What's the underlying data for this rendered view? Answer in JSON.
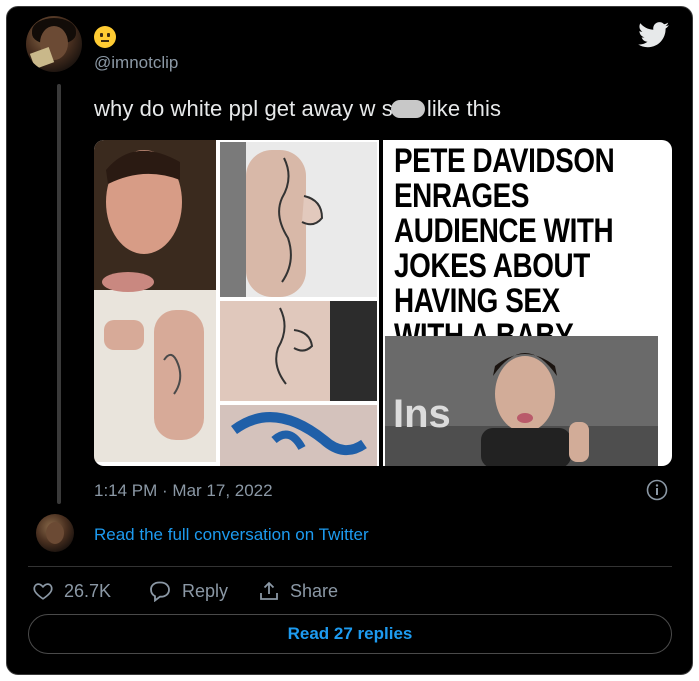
{
  "tweet": {
    "handle": "@imnotclip",
    "text_before": "why do white ppl get away w s",
    "text_after": "like this",
    "timestamp": "1:14 PM · Mar 17, 2022"
  },
  "media": {
    "headline": "PETE DAVIDSON ENRAGES AUDIENCE WITH JOKES ABOUT HAVING SEX WITH A BABY",
    "watermark": "Ins"
  },
  "conversation": {
    "link_label": "Read the full conversation on Twitter"
  },
  "actions": {
    "likes_count": "26.7K",
    "reply_label": "Reply",
    "share_label": "Share"
  },
  "replies_button": {
    "label": "Read 27 replies"
  },
  "colors": {
    "background": "#000000",
    "text": "#e7e9ea",
    "muted": "#8b98a5",
    "accent": "#1d9bf0"
  },
  "icons": [
    "neutral-face-emoji-icon",
    "twitter-bird-icon",
    "info-icon",
    "heart-icon",
    "reply-icon",
    "share-icon"
  ]
}
